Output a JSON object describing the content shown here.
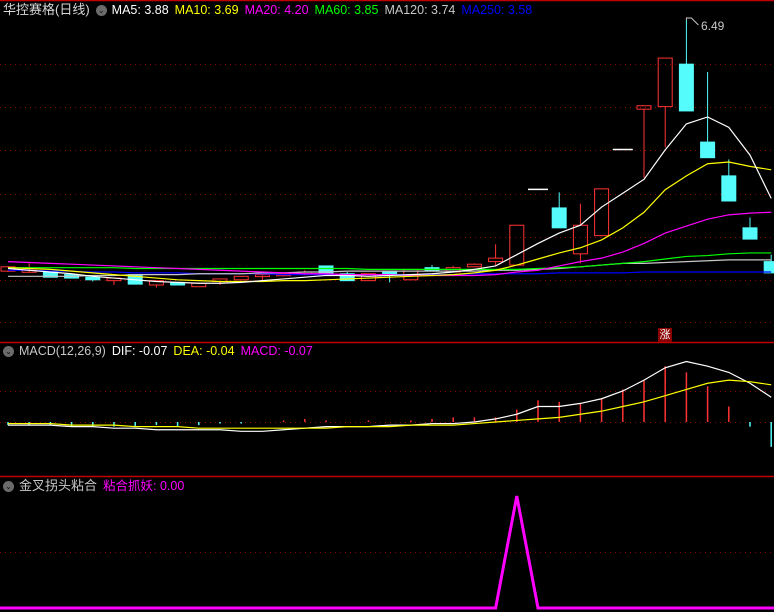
{
  "header": {
    "title": "华控赛格(日线)",
    "ma_labels": [
      {
        "text": "MA5: 3.88",
        "color": "#ffffff"
      },
      {
        "text": "MA10: 3.69",
        "color": "#ffff00"
      },
      {
        "text": "MA20: 4.20",
        "color": "#ff00ff"
      },
      {
        "text": "MA60: 3.85",
        "color": "#00ff00"
      },
      {
        "text": "MA120: 3.74",
        "color": "#c8c8c8"
      },
      {
        "text": "MA250: 3.58",
        "color": "#0000ff"
      }
    ]
  },
  "macd_header": {
    "title": "MACD(12,26,9)",
    "dif": "DIF: -0.07",
    "dea": "DEA: -0.04",
    "macd": "MACD: -0.07"
  },
  "signal_header": {
    "title": "金叉拐头粘合",
    "value": "粘合抓妖: 0.00"
  },
  "marker": "涨",
  "high_label": "6.49",
  "colors": {
    "up": "#ff3333",
    "down": "#54fcfc",
    "grid": "#8b0000",
    "border": "#c00000",
    "signal": "#ff00ff"
  },
  "chart_data": [
    {
      "type": "candlestick",
      "title": "华控赛格(日线)",
      "annotation": {
        "index": 32,
        "text": "6.49"
      },
      "ohlc": [
        [
          3.59,
          3.65,
          3.58,
          3.64
        ],
        [
          3.6,
          3.68,
          3.57,
          3.6
        ],
        [
          3.58,
          3.58,
          3.52,
          3.52
        ],
        [
          3.55,
          3.56,
          3.51,
          3.51
        ],
        [
          3.52,
          3.52,
          3.47,
          3.49
        ],
        [
          3.48,
          3.51,
          3.43,
          3.51
        ],
        [
          3.55,
          3.55,
          3.44,
          3.44
        ],
        [
          3.43,
          3.48,
          3.4,
          3.48
        ],
        [
          3.46,
          3.46,
          3.43,
          3.43
        ],
        [
          3.41,
          3.45,
          3.41,
          3.45
        ],
        [
          3.47,
          3.5,
          3.43,
          3.5
        ],
        [
          3.49,
          3.53,
          3.49,
          3.53
        ],
        [
          3.54,
          3.56,
          3.48,
          3.55
        ],
        [
          3.55,
          3.57,
          3.53,
          3.56
        ],
        [
          3.57,
          3.6,
          3.54,
          3.58
        ],
        [
          3.65,
          3.65,
          3.56,
          3.56
        ],
        [
          3.56,
          3.58,
          3.48,
          3.48
        ],
        [
          3.48,
          3.56,
          3.48,
          3.56
        ],
        [
          3.58,
          3.58,
          3.46,
          3.55
        ],
        [
          3.49,
          3.61,
          3.49,
          3.61
        ],
        [
          3.63,
          3.66,
          3.6,
          3.6
        ],
        [
          3.58,
          3.65,
          3.58,
          3.63
        ],
        [
          3.64,
          3.68,
          3.64,
          3.67
        ],
        [
          3.7,
          3.9,
          3.65,
          3.74
        ],
        [
          3.66,
          4.12,
          3.66,
          4.12
        ],
        [
          4.54,
          4.54,
          4.54,
          4.54
        ],
        [
          4.32,
          4.5,
          4.09,
          4.09
        ],
        [
          3.79,
          4.37,
          3.68,
          4.12
        ],
        [
          4.0,
          4.54,
          3.99,
          4.54
        ],
        [
          5.0,
          5.0,
          5.0,
          5.0
        ],
        [
          5.46,
          5.5,
          4.67,
          5.5
        ],
        [
          5.49,
          6.05,
          5.02,
          6.05
        ],
        [
          5.98,
          6.49,
          5.44,
          5.44
        ],
        [
          5.08,
          5.89,
          4.9,
          4.9
        ],
        [
          4.69,
          4.88,
          4.4,
          4.4
        ],
        [
          4.09,
          4.21,
          3.96,
          3.96
        ],
        [
          3.7,
          3.78,
          3.57,
          3.57
        ]
      ],
      "series": [
        {
          "name": "MA5",
          "color": "#ffffff",
          "values": [
            3.62,
            3.6,
            3.58,
            3.56,
            3.53,
            3.51,
            3.49,
            3.47,
            3.46,
            3.45,
            3.45,
            3.46,
            3.48,
            3.5,
            3.52,
            3.54,
            3.54,
            3.53,
            3.54,
            3.55,
            3.56,
            3.58,
            3.61,
            3.65,
            3.78,
            3.91,
            4.03,
            4.12,
            4.33,
            4.49,
            4.65,
            4.99,
            5.29,
            5.37,
            5.25,
            4.93,
            4.43
          ]
        },
        {
          "name": "MA10",
          "color": "#ffff00",
          "values": [
            3.63,
            3.62,
            3.61,
            3.59,
            3.57,
            3.55,
            3.53,
            3.51,
            3.49,
            3.48,
            3.47,
            3.47,
            3.47,
            3.48,
            3.48,
            3.49,
            3.5,
            3.51,
            3.52,
            3.53,
            3.54,
            3.55,
            3.57,
            3.6,
            3.66,
            3.73,
            3.8,
            3.86,
            3.95,
            4.09,
            4.27,
            4.53,
            4.69,
            4.83,
            4.85,
            4.8,
            4.76
          ]
        },
        {
          "name": "MA20",
          "color": "#ff00ff",
          "values": [
            3.7,
            3.69,
            3.68,
            3.67,
            3.66,
            3.65,
            3.64,
            3.63,
            3.62,
            3.61,
            3.6,
            3.59,
            3.58,
            3.57,
            3.56,
            3.56,
            3.55,
            3.55,
            3.55,
            3.54,
            3.54,
            3.54,
            3.54,
            3.55,
            3.58,
            3.6,
            3.65,
            3.7,
            3.74,
            3.81,
            3.91,
            4.03,
            4.11,
            4.19,
            4.24,
            4.26,
            4.27
          ]
        },
        {
          "name": "MA60",
          "color": "#00ff00",
          "values": [
            3.63,
            3.63,
            3.63,
            3.63,
            3.63,
            3.63,
            3.62,
            3.62,
            3.62,
            3.62,
            3.62,
            3.62,
            3.62,
            3.62,
            3.62,
            3.62,
            3.62,
            3.61,
            3.61,
            3.61,
            3.61,
            3.61,
            3.61,
            3.61,
            3.61,
            3.62,
            3.63,
            3.64,
            3.66,
            3.68,
            3.7,
            3.73,
            3.76,
            3.77,
            3.79,
            3.8,
            3.8
          ]
        },
        {
          "name": "MA120",
          "color": "#c8c8c8",
          "values": [
            3.53,
            3.53,
            3.53,
            3.53,
            3.54,
            3.54,
            3.55,
            3.55,
            3.55,
            3.56,
            3.56,
            3.56,
            3.57,
            3.57,
            3.58,
            3.58,
            3.59,
            3.59,
            3.59,
            3.59,
            3.59,
            3.59,
            3.59,
            3.6,
            3.6,
            3.61,
            3.62,
            3.64,
            3.66,
            3.68,
            3.68,
            3.69,
            3.7,
            3.71,
            3.72,
            3.72,
            3.72
          ]
        },
        {
          "name": "MA250",
          "color": "#0000ff",
          "values": [
            3.6,
            3.6,
            3.59,
            3.59,
            3.58,
            3.58,
            3.57,
            3.57,
            3.57,
            3.56,
            3.56,
            3.56,
            3.56,
            3.55,
            3.55,
            3.55,
            3.55,
            3.55,
            3.55,
            3.55,
            3.55,
            3.55,
            3.56,
            3.56,
            3.56,
            3.56,
            3.57,
            3.57,
            3.57,
            3.57,
            3.58,
            3.58,
            3.58,
            3.58,
            3.58,
            3.58,
            3.58
          ]
        }
      ]
    },
    {
      "type": "bar",
      "title": "MACD(12,26,9)",
      "macd": [
        -0.02,
        -0.02,
        -0.02,
        -0.03,
        -0.03,
        -0.03,
        -0.03,
        -0.02,
        -0.03,
        -0.02,
        -0.01,
        -0.01,
        0.0,
        0.01,
        0.02,
        0.01,
        0.0,
        0.01,
        0.0,
        0.01,
        0.02,
        0.03,
        0.03,
        0.03,
        0.08,
        0.14,
        0.13,
        0.12,
        0.15,
        0.21,
        0.27,
        0.36,
        0.32,
        0.23,
        0.1,
        -0.03,
        -0.16
      ],
      "series": [
        {
          "name": "DIF",
          "color": "#ffffff",
          "values": [
            -0.02,
            -0.02,
            -0.02,
            -0.03,
            -0.03,
            -0.04,
            -0.04,
            -0.05,
            -0.05,
            -0.05,
            -0.05,
            -0.06,
            -0.06,
            -0.05,
            -0.04,
            -0.03,
            -0.03,
            -0.03,
            -0.02,
            -0.02,
            -0.01,
            -0.01,
            0.0,
            0.02,
            0.05,
            0.1,
            0.1,
            0.12,
            0.15,
            0.2,
            0.27,
            0.35,
            0.39,
            0.36,
            0.32,
            0.25,
            0.16
          ]
        },
        {
          "name": "DEA",
          "color": "#ffff00",
          "values": [
            -0.01,
            -0.01,
            -0.01,
            -0.02,
            -0.02,
            -0.02,
            -0.03,
            -0.03,
            -0.03,
            -0.04,
            -0.04,
            -0.04,
            -0.04,
            -0.04,
            -0.04,
            -0.04,
            -0.03,
            -0.03,
            -0.03,
            -0.02,
            -0.02,
            -0.02,
            -0.01,
            0.0,
            0.01,
            0.02,
            0.03,
            0.05,
            0.07,
            0.1,
            0.13,
            0.17,
            0.21,
            0.25,
            0.27,
            0.26,
            0.24
          ]
        }
      ]
    },
    {
      "type": "line",
      "title": "金叉拐头粘合",
      "series": [
        {
          "name": "粘合抓妖",
          "color": "#ff00ff",
          "values": [
            0,
            0,
            0,
            0,
            0,
            0,
            0,
            0,
            0,
            0,
            0,
            0,
            0,
            0,
            0,
            0,
            0,
            0,
            0,
            0,
            0,
            0,
            0,
            0,
            1,
            0,
            0,
            0,
            0,
            0,
            0,
            0,
            0,
            0,
            0,
            0,
            0
          ]
        }
      ]
    }
  ]
}
